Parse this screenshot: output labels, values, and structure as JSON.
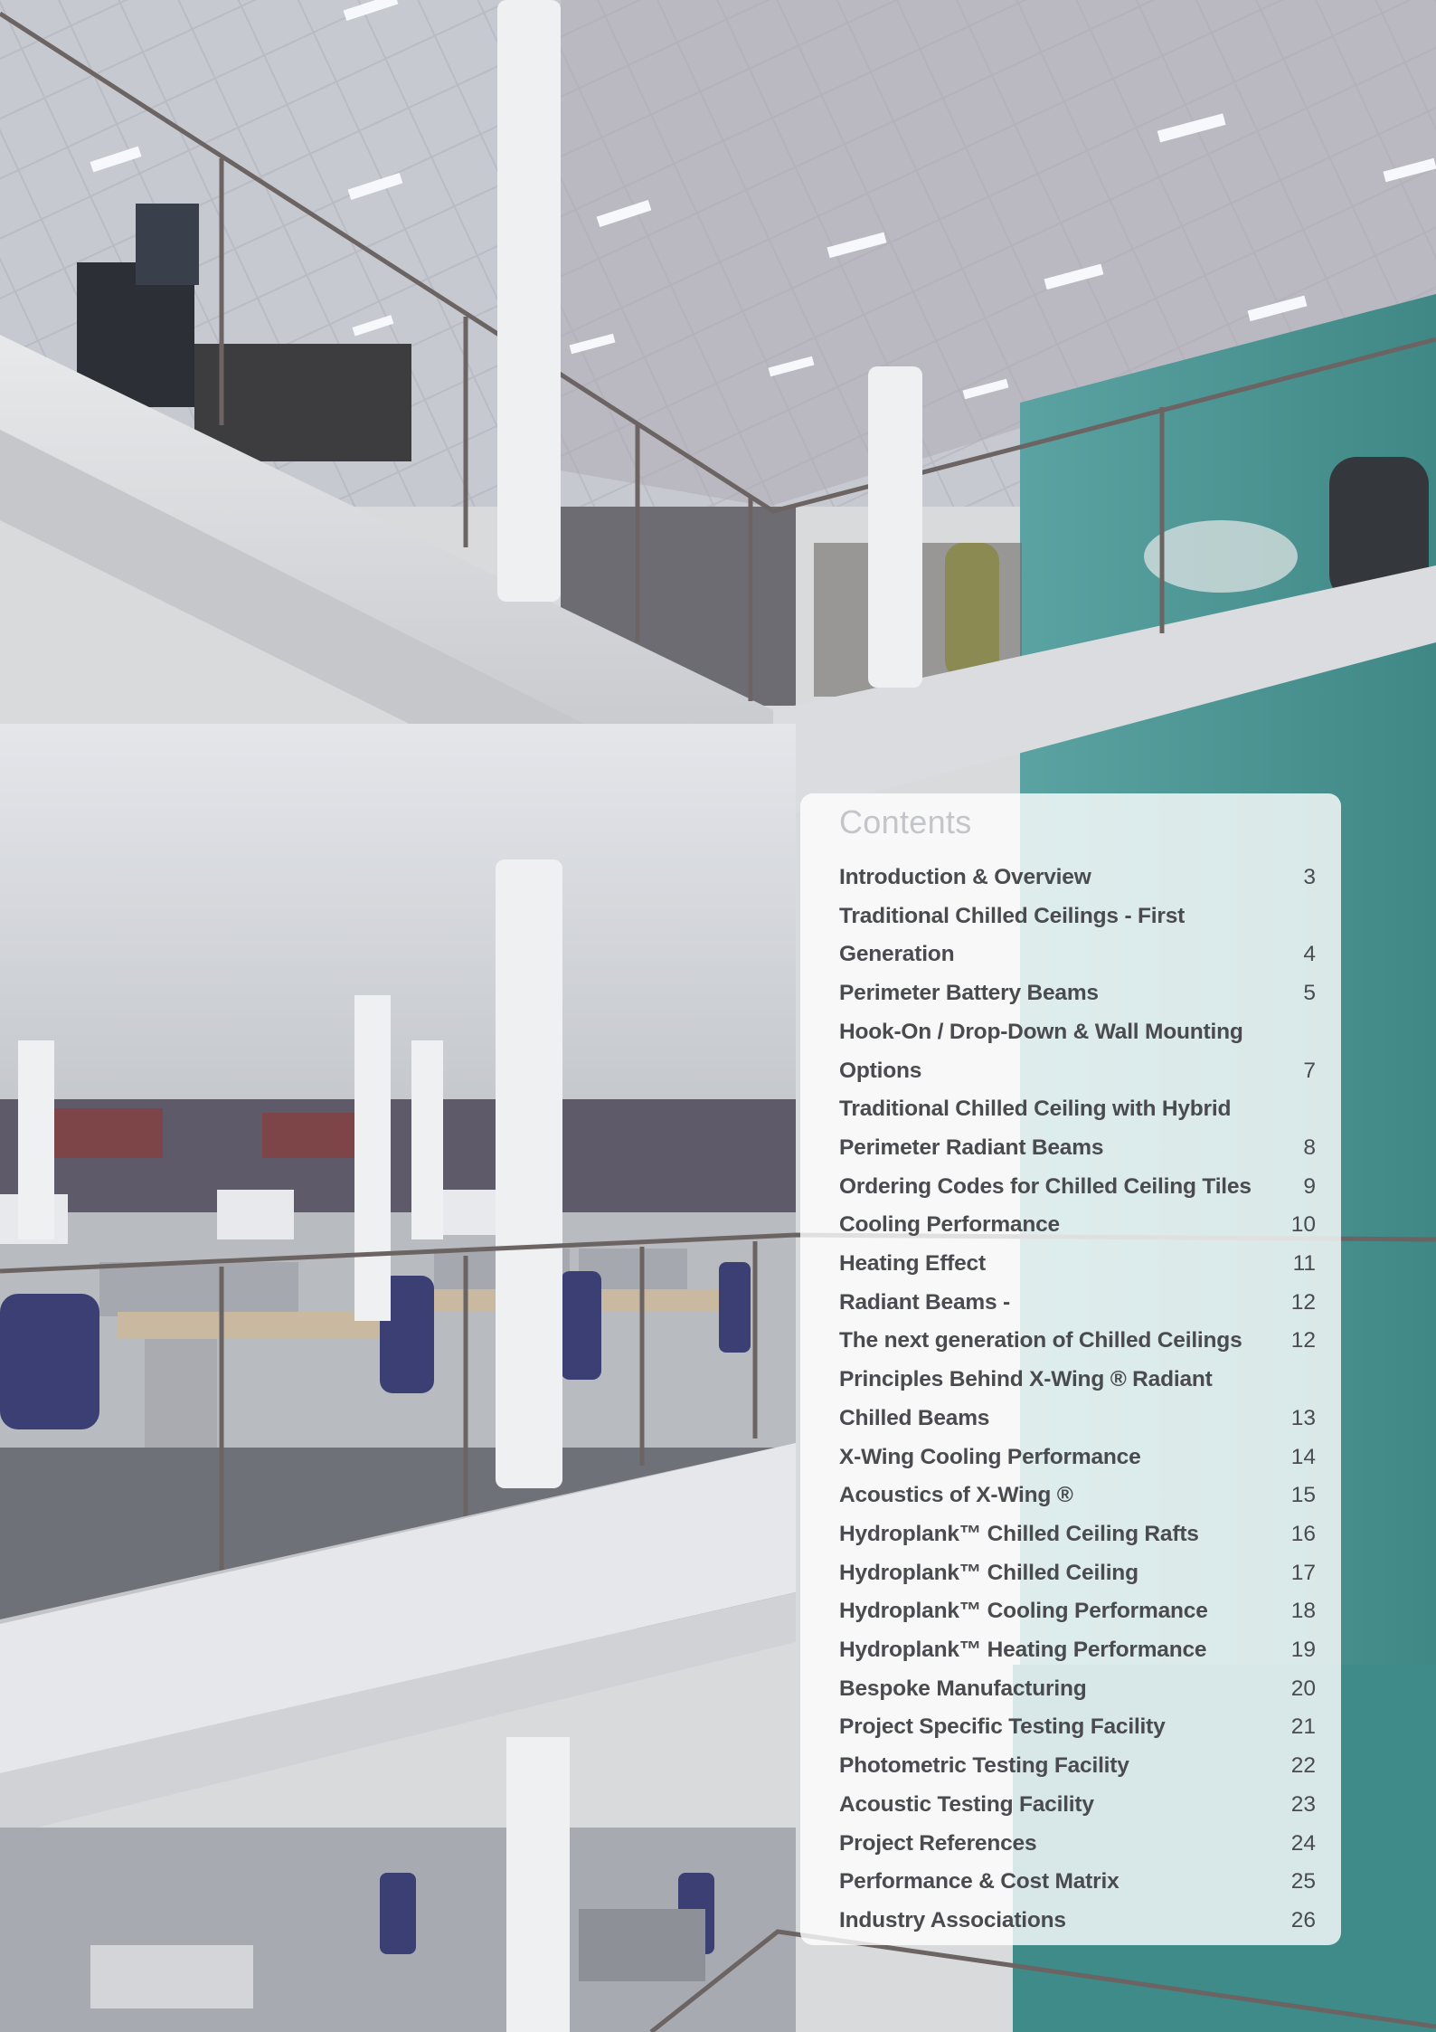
{
  "contents": {
    "title": "Contents",
    "entries": [
      {
        "title": "Introduction & Overview",
        "page": "3"
      },
      {
        "title": "Traditional Chilled Ceilings - First Generation",
        "page": "4"
      },
      {
        "title": "Perimeter Battery Beams",
        "page": "5"
      },
      {
        "title": "Hook-On / Drop-Down & Wall Mounting Options",
        "page": "7"
      },
      {
        "title": "Traditional Chilled Ceiling with Hybrid Perimeter Radiant Beams",
        "page": "8"
      },
      {
        "title": "Ordering Codes for Chilled Ceiling Tiles",
        "page": "9"
      },
      {
        "title": "Cooling Performance",
        "page": "10"
      },
      {
        "title": "Heating Effect",
        "page": "11"
      },
      {
        "title": "Radiant Beams -",
        "page": "12"
      },
      {
        "title": "The next generation of Chilled Ceilings",
        "page": "12"
      },
      {
        "title": "Principles Behind X-Wing ® Radiant Chilled Beams",
        "page": "13"
      },
      {
        "title": "X-Wing Cooling Performance",
        "page": "14"
      },
      {
        "title": "Acoustics of X-Wing ®",
        "page": "15"
      },
      {
        "title": "Hydroplank™ Chilled Ceiling Rafts",
        "page": "16"
      },
      {
        "title": "Hydroplank™ Chilled Ceiling",
        "page": "17"
      },
      {
        "title": "Hydroplank™ Cooling Performance",
        "page": "18"
      },
      {
        "title": "Hydroplank™ Heating Performance",
        "page": "19"
      },
      {
        "title": "Bespoke Manufacturing",
        "page": "20"
      },
      {
        "title": "Project Specific Testing Facility",
        "page": "21"
      },
      {
        "title": "Photometric Testing Facility",
        "page": "22"
      },
      {
        "title": "Acoustic Testing Facility",
        "page": "23"
      },
      {
        "title": "Project References",
        "page": "24"
      },
      {
        "title": "Performance & Cost Matrix",
        "page": "25"
      },
      {
        "title": "Industry Associations",
        "page": "26"
      }
    ]
  },
  "colors": {
    "panel_background": "#ffffff",
    "title_text": "#c4c5c8",
    "entry_text": "#4a4b4f",
    "teal_wall": "#4e9a98"
  }
}
